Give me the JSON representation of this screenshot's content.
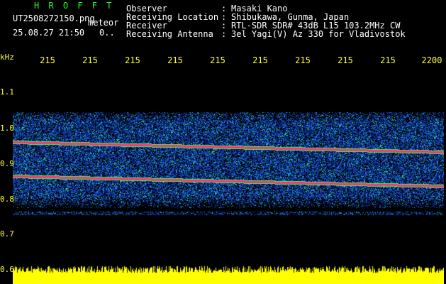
{
  "header": {
    "title": "H R O F F T",
    "filename": "UT2508272150.png",
    "tag": "meteor",
    "datetime": "25.08.27 21:50",
    "count": "0..",
    "fields": [
      {
        "label": "Observer",
        "value": "Masaki Kano"
      },
      {
        "label": "Receiving Location",
        "value": "Shibukawa, Gunma, Japan"
      },
      {
        "label": "Receiver",
        "value": "RTL-SDR SDR# 43dB L15 103.2MHz CW"
      },
      {
        "label": "Receiving Antenna",
        "value": "3el Yagi(V) Az 330 for Vladivostok"
      }
    ]
  },
  "axis": {
    "unit": "kHz",
    "time_ticks": [
      "215",
      "215",
      "215",
      "215",
      "215",
      "215",
      "215",
      "215",
      "215",
      "2200"
    ],
    "freq_ticks": [
      "1.1",
      "1.0",
      "0.9",
      "0.8",
      "0.7",
      "0.6"
    ]
  },
  "colors": {
    "background": "#000000",
    "label": "#ffff30",
    "title": "#22ff22",
    "noise": "#1a2fd0",
    "carrier": "#ff3070",
    "amplitude": "#ffff00"
  }
}
